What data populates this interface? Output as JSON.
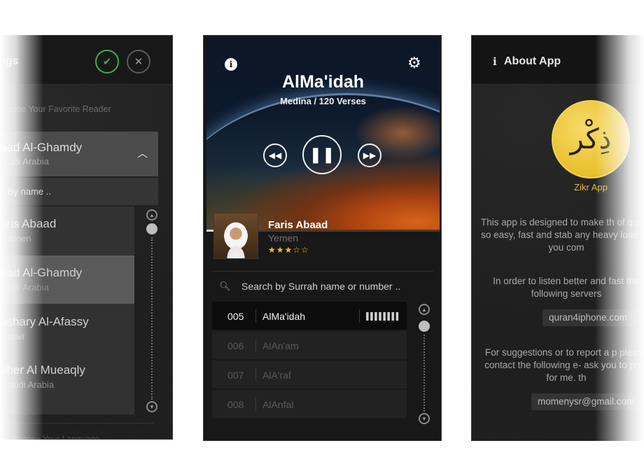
{
  "settings_panel": {
    "title": "ngs",
    "ok_icon": "check-icon",
    "close_icon": "close-icon",
    "section_label": "oose Your Favorite Reader",
    "selected_reader": {
      "name": "aad Al-Ghamdy",
      "country": "udi Arabia"
    },
    "search_placeholder": "h By name ..",
    "readers": [
      {
        "name": "aris Abaad",
        "country": "emen"
      },
      {
        "name": "aad Al-Ghamdy",
        "country": "udi Arabia"
      },
      {
        "name": "ashary Al-Afassy",
        "country": "wait"
      },
      {
        "name": "aher Al Mueaqly",
        "country": "audi Arabia"
      },
      {
        "name": "",
        "country": ""
      }
    ],
    "footer_label": "e / Choose Your Language"
  },
  "player_panel": {
    "surah_title": "AlMa'idah",
    "surah_meta": "Medina / 120 Verses",
    "progress": 0.07,
    "reader": {
      "name": "Faris Abaad",
      "country": "Yemen",
      "stars": "★★★☆☆"
    },
    "search_placeholder": "Search by Surrah name or number ..",
    "surahs": [
      {
        "num": "005",
        "name": "AlMa'idah",
        "active": true,
        "eq": "▌▌▌▌▌▌▌▌"
      },
      {
        "num": "006",
        "name": "AlAn'am",
        "active": false
      },
      {
        "num": "007",
        "name": "AlA'raf",
        "active": false
      },
      {
        "num": "008",
        "name": "AlAnfal",
        "active": false
      }
    ]
  },
  "about_panel": {
    "title": "About App",
    "logo_text": "ذِكْر",
    "logo_caption": "Zikr App",
    "para1": "This app is designed to make th of quran so easy, fast and stab any heavy load on you com",
    "para2": "In order to listen better and fast the following servers",
    "server": "quran4iphone.com",
    "para3": "For suggestions or to report a p please contact the following e- ask you to pray for me. th",
    "email": "momenysr@gmail.com"
  },
  "colors": {
    "accent_green": "#3fae4a",
    "star_gold": "#f2c21b",
    "logo_gold": "#e8bf2a"
  }
}
